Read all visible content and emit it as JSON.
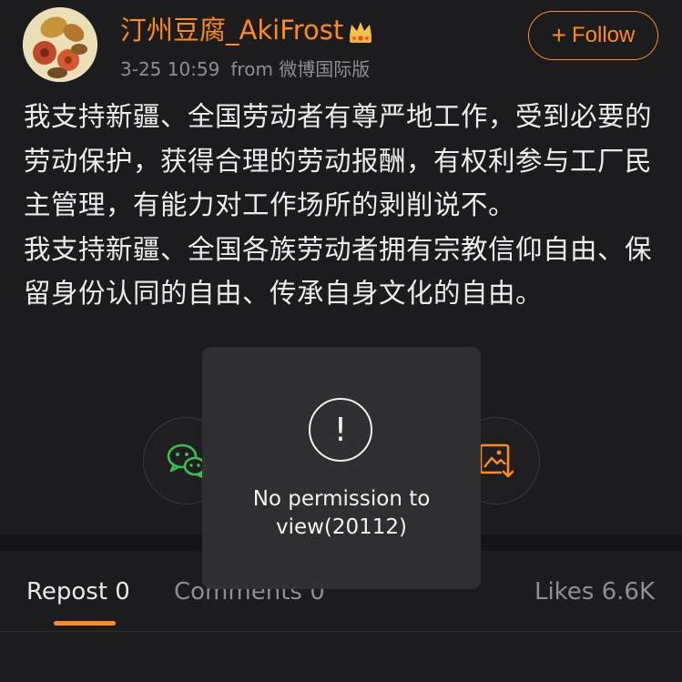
{
  "post": {
    "username": "汀州豆腐_AkiFrost",
    "timestamp": "3-25 10:59",
    "source": "from 微博国际版",
    "follow_label": "Follow",
    "paragraphs": [
      "我支持新疆、全国劳动者有尊严地工作，受到必要的劳动保护，获得合理的劳动报酬，有权利参与工厂民主管理，有能力对工作场所的剥削说不。",
      "我支持新疆、全国各族劳动者拥有宗教信仰自由、保留身份认同的自由、传承自身文化的自由。"
    ]
  },
  "share_buttons": [
    "wechat-icon",
    "moments-icon",
    "save-image-icon"
  ],
  "tabs": {
    "repost": "Repost 0",
    "comments": "Comments 0",
    "likes": "Likes 6.6K"
  },
  "toast": {
    "icon": "!",
    "message": "No permission to view(20112)"
  },
  "colors": {
    "accent": "#ff8a1c",
    "background": "#1c1c1e",
    "wechat_green": "#3dbf4e"
  }
}
